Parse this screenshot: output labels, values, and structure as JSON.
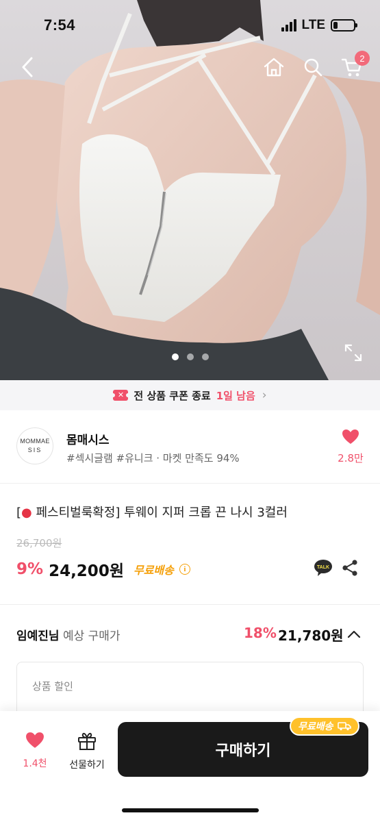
{
  "status_bar": {
    "time": "7:54",
    "network": "LTE"
  },
  "header": {
    "back_icon": "chevron-left-icon",
    "home_icon": "home-icon",
    "search_icon": "search-icon",
    "cart_icon": "cart-icon",
    "cart_count": "2"
  },
  "gallery": {
    "total_slides": 3,
    "active_slide": 1,
    "expand_icon": "expand-icon"
  },
  "coupon_banner": {
    "text": "전 상품 쿠폰 종료",
    "highlight": "1일 남음",
    "icon": "coupon-icon",
    "accent": "#f0506a"
  },
  "store": {
    "logo_line1": "MOMMAE",
    "logo_line2": "SIS",
    "name": "몸매시스",
    "tags": "#섹시글램 #유니크 · 마켓 만족도 94%",
    "favorite_count": "2.8만"
  },
  "product": {
    "title_bracket": "[",
    "title_rest": " 페스티벌룩확정] 투웨이 지퍼 크롭 끈 나시 3컬러",
    "original_price": "26,700원",
    "discount_rate": "9%",
    "price": "24,200원",
    "free_shipping": "무료배송",
    "info_icon": "i"
  },
  "expected": {
    "user": "임예진님",
    "label": " 예상 구매가",
    "discount_rate": "18%",
    "price": "21,780원"
  },
  "discount_box": {
    "label": "상품 할인"
  },
  "bottom_bar": {
    "like_count": "1.4천",
    "gift_label": "선물하기",
    "buy_label": "구매하기",
    "ship_badge": "무료배송"
  },
  "colors": {
    "brand_pink": "#f0506a",
    "ship_yellow": "#ffc12b",
    "buy_button": "#1a1a1a"
  }
}
